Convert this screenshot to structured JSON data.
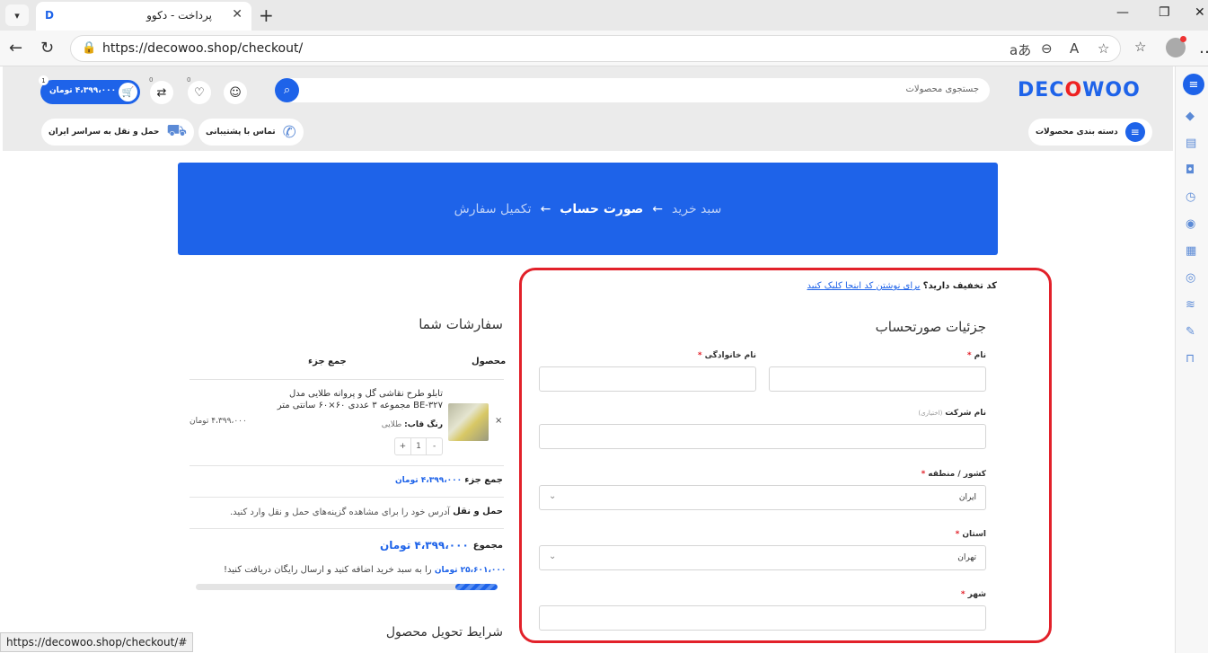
{
  "browser": {
    "tab_title": "پرداخت - دکوو",
    "url": "https://decowoo.shop/checkout/",
    "status_url": "https://decowoo.shop/checkout/#"
  },
  "header": {
    "logo_pre": "DEC",
    "logo_o": "O",
    "logo_post": "WOO",
    "search_placeholder": "جستجوی محصولات",
    "cart_amount": "۴،۳۹۹،۰۰۰ تومان",
    "cart_count": "1",
    "compare_count": "0",
    "wishlist_count": "0",
    "categories": "دسته بندی محصولات",
    "support": "تماس با پشتیبانی",
    "shipping": "حمل و نقل به سراسر ایران"
  },
  "steps": {
    "cart": "سبد خرید",
    "account": "صورت حساب",
    "complete": "تکمیل سفارش",
    "arrow": "←"
  },
  "billing": {
    "coupon_question": "کد تخفیف دارید؟",
    "coupon_link": "برای نوشتن کد اینجا کلیک کنید",
    "title": "جزئیات صورتحساب",
    "first_name": "نام",
    "last_name": "نام خانوادگی",
    "company": "نام شرکت",
    "optional": "(اختیاری)",
    "country": "کشور / منطقه",
    "country_value": "ایران",
    "state": "استان",
    "state_value": "تهران",
    "city": "شهر",
    "required": "*"
  },
  "order": {
    "title": "سفارشات شما",
    "col_product": "محصول",
    "col_subtotal": "جمع جزء",
    "product_name": "تابلو طرح نقاشی گل و پروانه طلایی مدل BE-۳۲۷ مجموعه ۳ عددی ۶۰×۶۰ سانتی متر",
    "product_price": "۴،۳۹۹،۰۰۰ تومان",
    "attr_label": "رنگ قاب:",
    "attr_value": "طلایی",
    "qty": "1",
    "qty_minus": "-",
    "qty_plus": "+",
    "remove": "×",
    "subtotal_label": "جمع جزء",
    "subtotal_value": "۴،۳۹۹،۰۰۰ تومان",
    "shipping_label": "حمل و نقل",
    "shipping_note": "آدرس خود را برای مشاهده گزینه‌های حمل و نقل وارد کنید.",
    "total_label": "مجموع",
    "total_value": "۴،۳۹۹،۰۰۰ تومان",
    "free_amount": "۲۵،۶۰۱،۰۰۰ تومان",
    "free_note": "را به سبد خرید اضافه کنید و ارسال رایگان دریافت کنید!",
    "free_progress": 0.14,
    "terms_title": "شرایط تحویل محصول"
  }
}
